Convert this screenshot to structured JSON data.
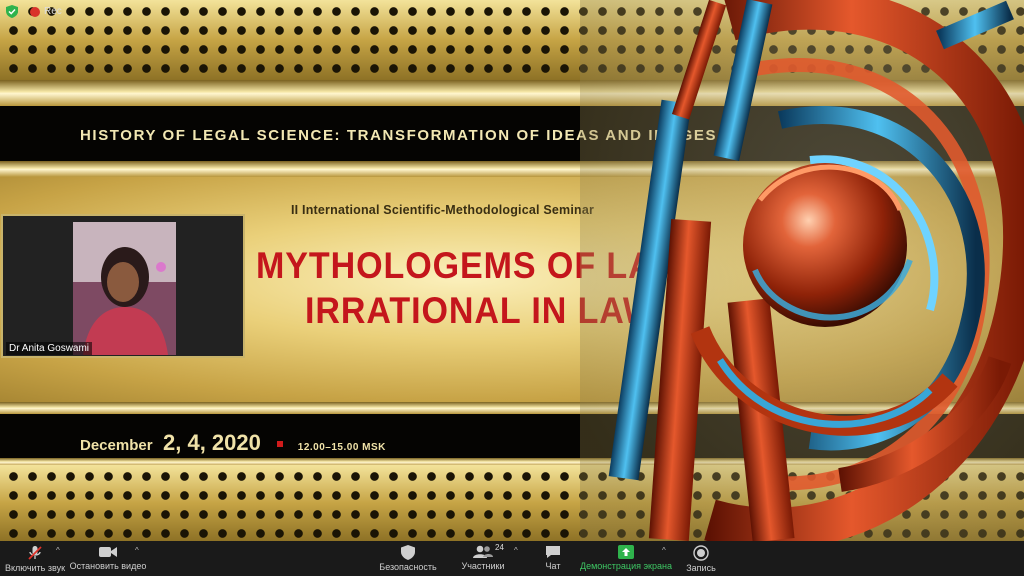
{
  "status": {
    "rec_label": "Rec"
  },
  "slide": {
    "banner_title": "HISTORY OF LEGAL SCIENCE: TRANSFORMATION OF IDEAS AND IMAGES",
    "subtitle": "II International Scientific-Methodological Seminar",
    "headline_1": "MYTHOLOGEMS OF LAW:",
    "headline_2": "IRRATIONAL IN LAW",
    "date_month": "December",
    "date_days": "2, 4, 2020",
    "date_time": "12.00–15.00 MSK"
  },
  "video": {
    "participant_name": "Dr Anita Goswami"
  },
  "toolbar": {
    "unmute": "Включить звук",
    "stop_video": "Остановить видео",
    "security": "Безопасность",
    "participants": "Участники",
    "participants_count": "24",
    "chat": "Чат",
    "share_screen": "Демонстрация экрана",
    "record": "Запись"
  },
  "colors": {
    "accent_red": "#c4161c",
    "share_green": "#3ec764",
    "toolbar_bg": "#1a1a1a"
  }
}
